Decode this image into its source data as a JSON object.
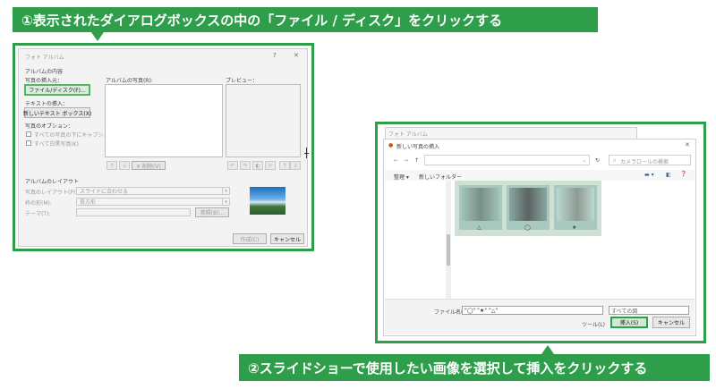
{
  "callouts": {
    "step1": "①表示されたダイアログボックスの中の「ファイル / ディスク」をクリックする",
    "step2": "②スライドショーで使用したい画像を選択して挿入をクリックする"
  },
  "dialog1": {
    "title": "フォト アルバム",
    "help": "?",
    "close": "✕",
    "album_contents": "アルバムの内容",
    "insert_picture_from": "写真の挿入元：",
    "file_disk_button": "ファイル/ディスク(F)...",
    "insert_text": "テキストの挿入：",
    "new_textbox_button": "新しいテキスト ボックス(X)",
    "picture_options": "写真のオプション：",
    "option_captions": "すべての写真の下にキャプション(A)",
    "option_bw": "すべて白黒写真(K)",
    "pictures_in_album": "アルバムの写真(R):",
    "preview": "プレビュー：",
    "remove_button": "✕ 削除(V)",
    "album_layout": "アルバムのレイアウト",
    "picture_layout_label": "写真のレイアウト(P):",
    "picture_layout_value": "スライドに合わせる",
    "frame_shape_label": "枠の形(M):",
    "frame_shape_value": "長方形",
    "theme_label": "テーマ(T):",
    "browse_button": "参照(B)...",
    "create_button": "作成(C)",
    "cancel_button": "キャンセル"
  },
  "dialog2": {
    "back_title": "フォト アルバム",
    "title": "新しい写真の挿入",
    "close": "✕",
    "nav_back": "←",
    "nav_forward": "→",
    "nav_up": "↑",
    "refresh": "↻",
    "search_placeholder": "カメラロールの検索",
    "organize": "整理 ▾",
    "new_folder": "新しいフォルダー",
    "thumbnails": [
      {
        "caption": "△"
      },
      {
        "caption": "◯"
      },
      {
        "caption": "★"
      }
    ],
    "filename_label": "ファイル名(N):",
    "filename_value": "\"◯\" \"★\" \"△\"",
    "filetype_value": "すべての図",
    "tools": "ツール(L)",
    "insert_button": "挿入(S)",
    "cancel_button": "キャンセル"
  },
  "colors": {
    "accent": "#2e9e4a",
    "highlight_fill": "#d7efd9"
  }
}
